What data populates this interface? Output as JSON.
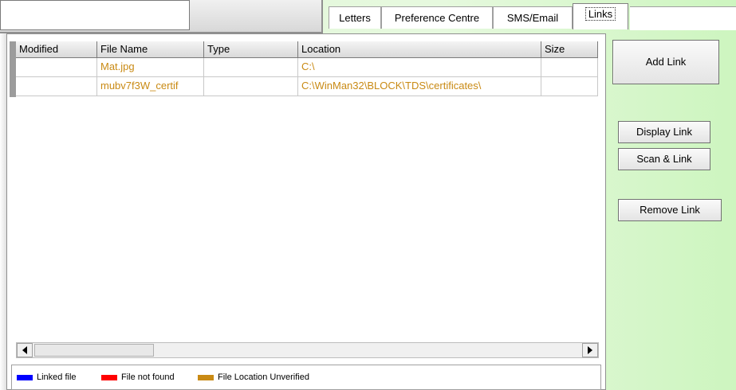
{
  "tabs": [
    {
      "label": "Letters"
    },
    {
      "label": "Preference Centre"
    },
    {
      "label": "SMS/Email"
    },
    {
      "label": "Links"
    }
  ],
  "grid": {
    "columns": [
      "Modified",
      "File Name",
      "Type",
      "Location",
      "Size"
    ],
    "rows": [
      {
        "modified": "",
        "file_name": "Mat.jpg",
        "type": "",
        "location": "C:\\",
        "size": ""
      },
      {
        "modified": "",
        "file_name": "mubv7f3W_certif",
        "type": "",
        "location": "C:\\WinMan32\\BLOCK\\TDS\\certificates\\",
        "size": ""
      }
    ]
  },
  "buttons": {
    "add_link": "Add Link",
    "display_link": "Display Link",
    "scan_link": "Scan & Link",
    "remove_link": "Remove Link"
  },
  "legend": {
    "items": [
      {
        "label": "Linked file",
        "color": "#0000ff"
      },
      {
        "label": "File not found",
        "color": "#ff0000"
      },
      {
        "label": "File Location Unverified",
        "color": "#c98a14"
      }
    ]
  },
  "colors": {
    "unverified_text": "#c98a14",
    "panel_green": "#e2f7d9"
  }
}
